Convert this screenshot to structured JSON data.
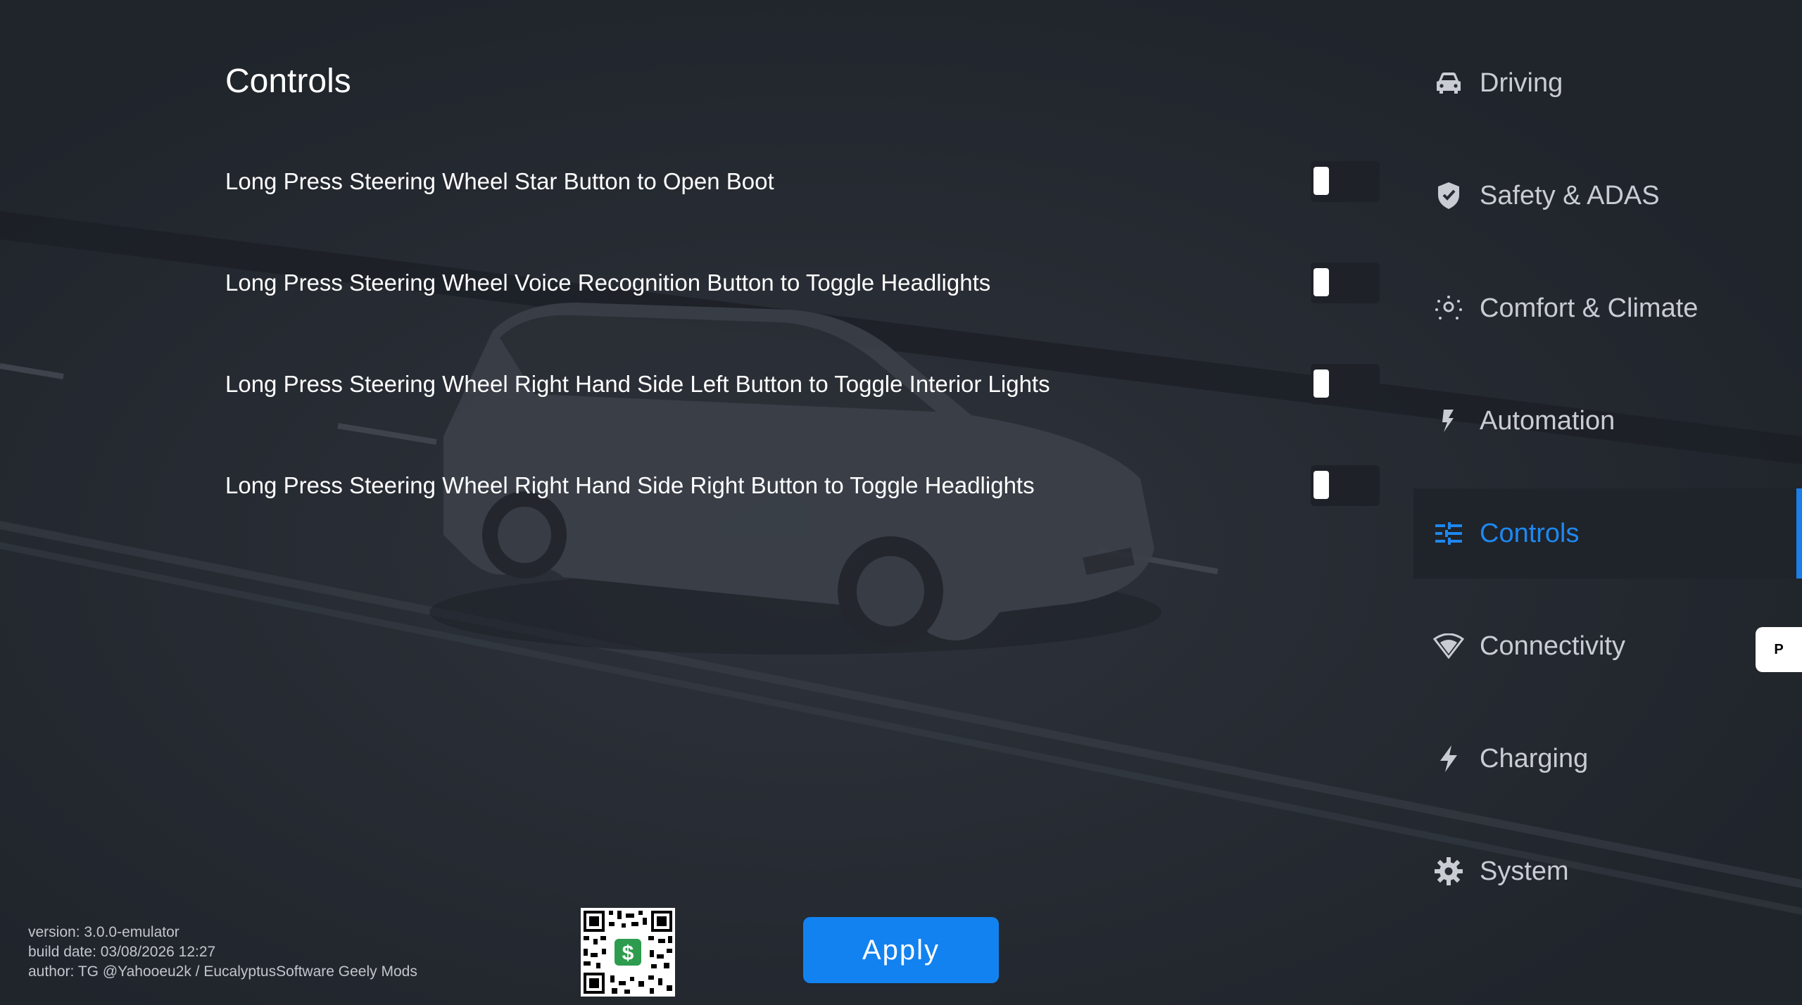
{
  "page": {
    "title": "Controls"
  },
  "settings": [
    {
      "label": "Long Press Steering Wheel Star Button to Open Boot",
      "enabled": false
    },
    {
      "label": "Long Press Steering Wheel Voice Recognition Button to Toggle Headlights",
      "enabled": false
    },
    {
      "label": "Long Press Steering Wheel Right Hand Side Left Button to Toggle Interior Lights",
      "enabled": false
    },
    {
      "label": "Long Press Steering Wheel Right Hand Side Right Button to Toggle Headlights",
      "enabled": false
    }
  ],
  "sidebar": {
    "items": [
      {
        "label": "Driving",
        "icon": "car-icon"
      },
      {
        "label": "Safety & ADAS",
        "icon": "shield-icon"
      },
      {
        "label": "Comfort & Climate",
        "icon": "sun-icon"
      },
      {
        "label": "Automation",
        "icon": "automation-icon"
      },
      {
        "label": "Controls",
        "icon": "controls-icon",
        "active": true
      },
      {
        "label": "Connectivity",
        "icon": "wifi-icon"
      },
      {
        "label": "Charging",
        "icon": "bolt-icon"
      },
      {
        "label": "System",
        "icon": "gear-icon"
      }
    ]
  },
  "badge": {
    "label": "P"
  },
  "footer": {
    "version": "version: 3.0.0-emulator",
    "build_date": "build date: 03/08/2026 12:27",
    "author": "author: TG @Yahooeu2k / EucalyptusSoftware Geely Mods"
  },
  "apply_label": "Apply",
  "colors": {
    "background": "#262a32",
    "accent": "#1282f0",
    "active_nav_bg": "#1f232a",
    "nav_text": "#c9ccd2"
  }
}
